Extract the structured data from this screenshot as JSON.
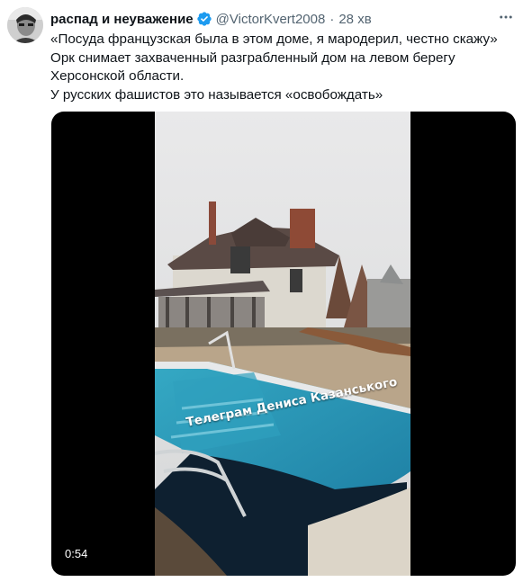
{
  "tweet": {
    "display_name": "распад и неуважение",
    "handle": "@VictorKvert2008",
    "separator": "·",
    "time": "28 хв",
    "text_lines": [
      "«Посуда французская была в этом доме, я мародерил, честно скажу»",
      "Орк снимает захваченный разграбленный дом на левом берегу",
      "Херсонской области.",
      "У русских фашистов это называется «освобождать»"
    ]
  },
  "video": {
    "watermark": "Телеграм Дениса Казанського",
    "duration": "0:54"
  },
  "colors": {
    "verified_badge": "#1d9bf0",
    "secondary_text": "#536471",
    "media_background": "#000000"
  },
  "icons": {
    "verified": "verified-badge-icon",
    "more": "more-options-icon"
  }
}
